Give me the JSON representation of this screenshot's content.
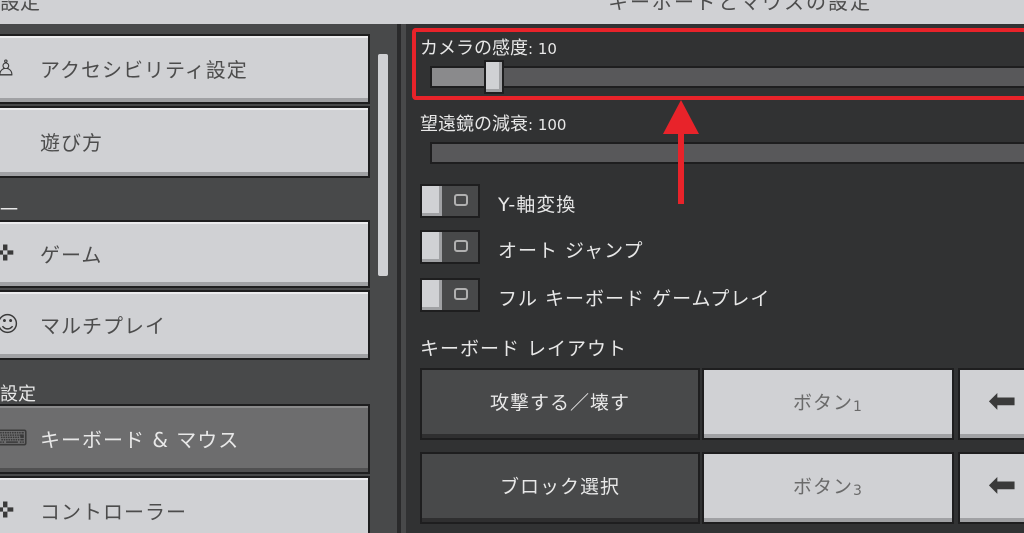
{
  "header": {
    "left_title": "設定",
    "center_title": "キーボードとマウスの設定"
  },
  "sidebar": {
    "items": [
      {
        "label": "アクセシビリティ設定",
        "icon": "accessibility-icon"
      },
      {
        "label": "遊び方",
        "icon": ""
      },
      {
        "label": "ゲーム",
        "icon": "controller-icon"
      },
      {
        "label": "マルチプレイ",
        "icon": "players-icon"
      },
      {
        "label": "キーボード & マウス",
        "icon": "keyboard-mouse-icon",
        "selected": true
      },
      {
        "label": "コントローラー",
        "icon": "controller-icon"
      }
    ],
    "sections": {
      "general": "一",
      "settings": "設定"
    }
  },
  "settings": {
    "camera_sensitivity": {
      "label": "カメラの感度",
      "value": "10",
      "fraction": 0.1
    },
    "spyglass_damping": {
      "label": "望遠鏡の減衰",
      "value": "100",
      "fraction": 1.0
    },
    "toggles": [
      {
        "label": "Y-軸変換",
        "on": false
      },
      {
        "label": "オート ジャンプ",
        "on": false
      },
      {
        "label": "フル キーボード ゲームプレイ",
        "on": false
      }
    ],
    "keyboard_layout": {
      "heading": "キーボード レイアウト",
      "rows": [
        {
          "action": "攻撃する／壊す",
          "binding": "ボタン",
          "binding_num": "1"
        },
        {
          "action": "ブロック選択",
          "binding": "ボタン",
          "binding_num": "3"
        }
      ]
    }
  },
  "annotation": {
    "color": "#e8232a"
  }
}
